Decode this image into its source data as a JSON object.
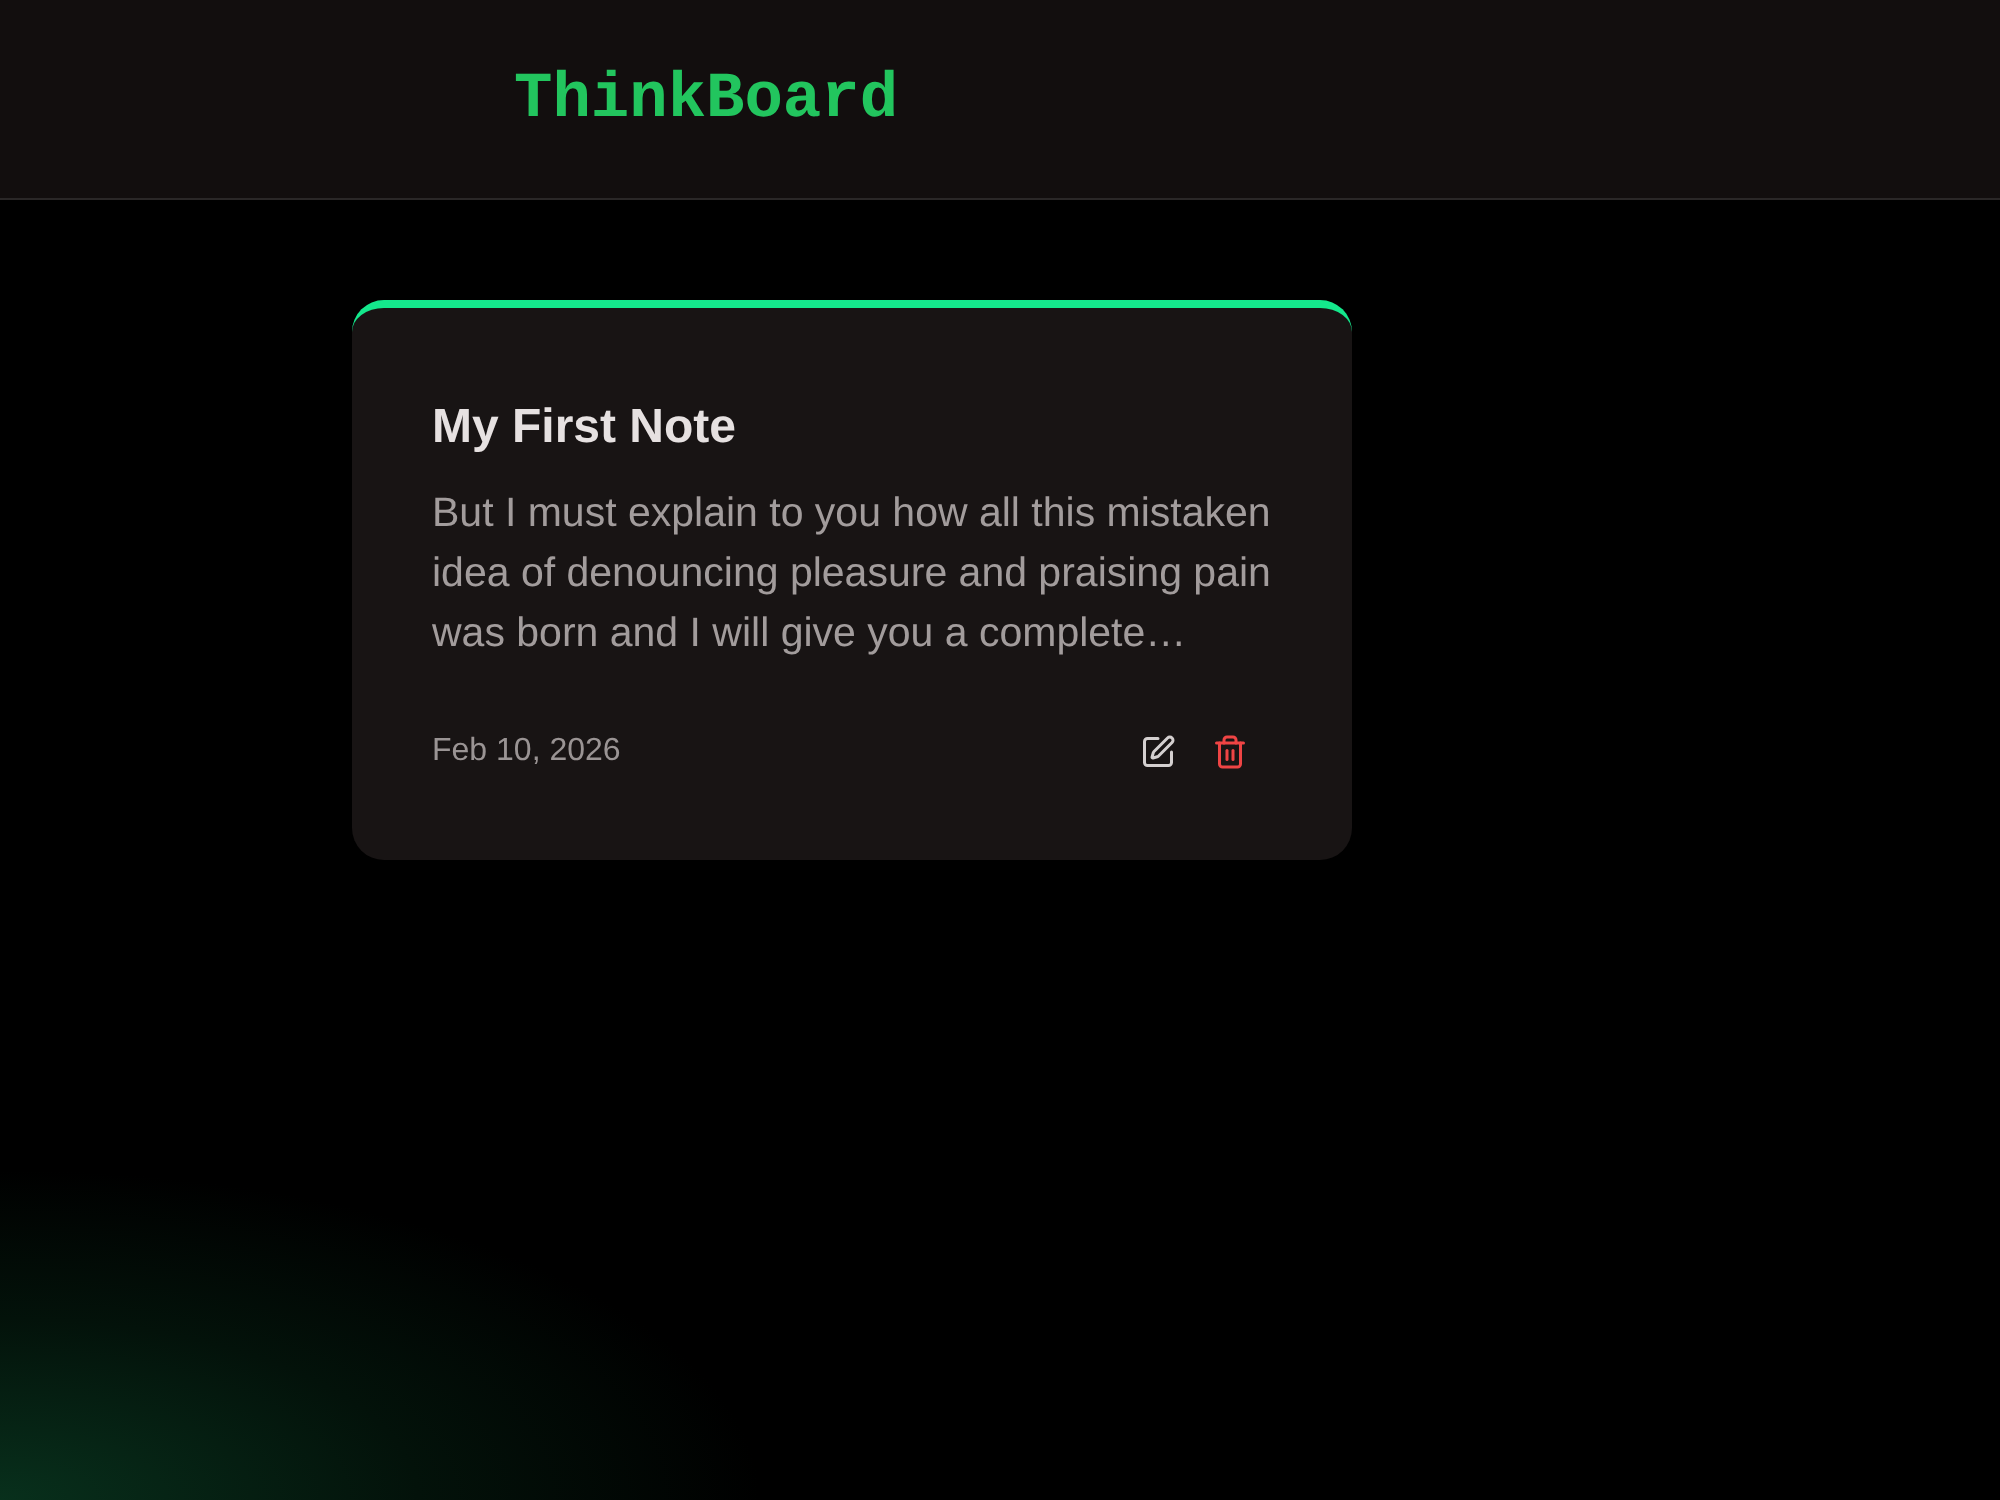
{
  "header": {
    "logo": "ThinkBoard"
  },
  "notes": [
    {
      "title": "My First Note",
      "excerpt": "But I must explain to you how all this mistaken idea of denouncing pleasure and praising pain was born and I will give you a complete…",
      "date": "Feb 10, 2026"
    }
  ]
}
